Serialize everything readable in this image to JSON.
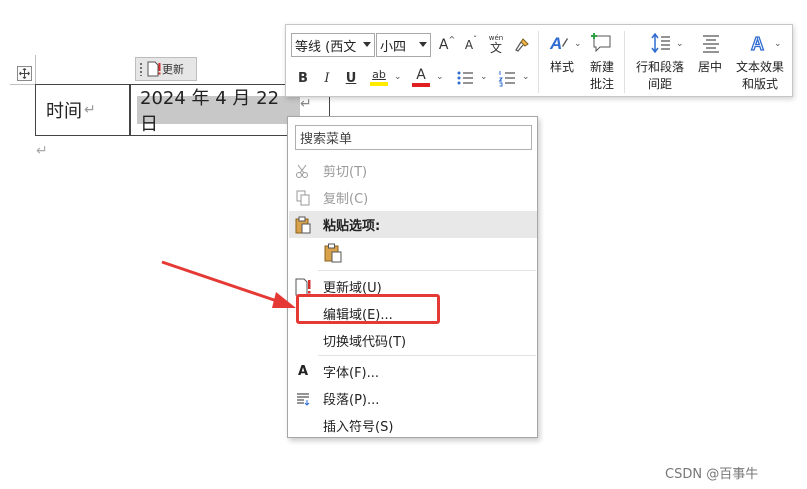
{
  "document": {
    "table": {
      "cell_label": "时间",
      "date_value": "2024 年 4 月 22 日",
      "paragraph_mark": "↵"
    },
    "field_tag": {
      "label": "更新"
    }
  },
  "mini_toolbar": {
    "font_name": "等线 (西文",
    "font_size": "小四",
    "grow_font": "A",
    "shrink_font": "A",
    "phonetic": "文",
    "phonetic_top": "wén",
    "format_painter": "🖌",
    "bold": "B",
    "italic": "I",
    "underline": "U",
    "highlight": "ab",
    "font_color": "A",
    "bullets": "☰",
    "numbering": "☰",
    "styles_label": "样式",
    "new_comment_label_1": "新建",
    "new_comment_label_2": "批注",
    "line_spacing_label_1": "行和段落",
    "line_spacing_label_2": "间距",
    "center_label": "居中",
    "text_effects_label_1": "文本效果",
    "text_effects_label_2": "和版式",
    "highlight_color": "#ffeb00",
    "font_color_bar": "#e02020"
  },
  "context_menu": {
    "search_placeholder": "搜索菜单",
    "items": [
      {
        "label": "剪切(T)",
        "icon": "scissors-icon",
        "glyph": "✂",
        "disabled": true
      },
      {
        "label": "复制(C)",
        "icon": "copy-icon",
        "glyph": "⎘",
        "disabled": true
      },
      {
        "label": "粘贴选项:",
        "icon": "paste-icon",
        "glyph": "📋",
        "header": true
      },
      {
        "label": "",
        "icon": "paste-keep-text-icon",
        "glyph": "📋"
      },
      {
        "label": "更新域(U)",
        "icon": "update-field-icon",
        "glyph": "!"
      },
      {
        "label": "编辑域(E)...",
        "icon": "",
        "glyph": ""
      },
      {
        "label": "切换域代码(T)",
        "icon": "",
        "glyph": ""
      },
      {
        "label": "字体(F)...",
        "icon": "font-icon",
        "glyph": "A"
      },
      {
        "label": "段落(P)...",
        "icon": "paragraph-icon",
        "glyph": "≣"
      },
      {
        "label": "插入符号(S)",
        "icon": "",
        "glyph": ""
      }
    ]
  },
  "annotation": {
    "box_color": "#e53935",
    "arrow_color": "#e53935"
  },
  "watermark": "CSDN @百事牛"
}
